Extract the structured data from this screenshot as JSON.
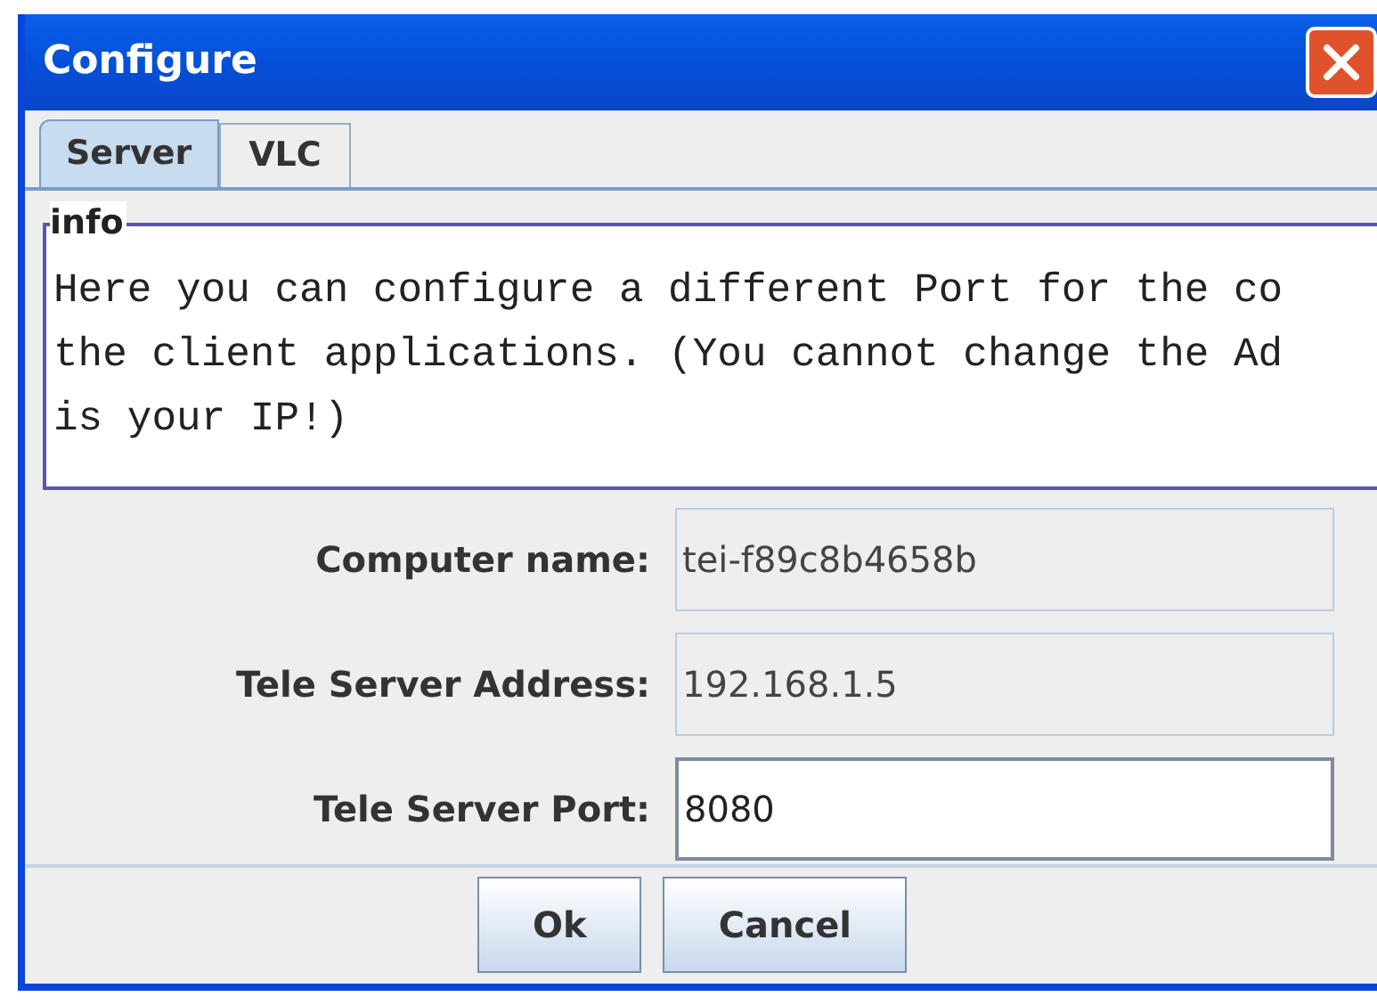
{
  "window": {
    "title": "Configure"
  },
  "tabs": [
    {
      "label": "Server",
      "selected": true
    },
    {
      "label": "VLC",
      "selected": false
    }
  ],
  "info": {
    "legend": "info",
    "lines": [
      "Here you can configure a different Port for the co",
      "the client applications. (You cannot change the Ad",
      "is your IP!)"
    ]
  },
  "fields": [
    {
      "label": "Computer name:",
      "value": "tei-f89c8b4658b",
      "disabled": true
    },
    {
      "label": "Tele Server Address:",
      "value": "192.168.1.5",
      "disabled": true
    },
    {
      "label": "Tele Server Port:",
      "value": "8080",
      "disabled": false
    }
  ],
  "buttons": [
    "Ok",
    "Cancel"
  ]
}
